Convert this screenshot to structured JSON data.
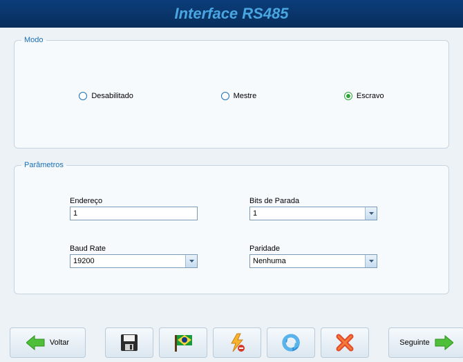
{
  "header": {
    "title": "Interface RS485"
  },
  "modo": {
    "legend": "Modo",
    "options": [
      {
        "label": "Desabilitado",
        "selected": false
      },
      {
        "label": "Mestre",
        "selected": false
      },
      {
        "label": "Escravo",
        "selected": true
      }
    ]
  },
  "param": {
    "legend": "Parâmetros",
    "endereco": {
      "label": "Endereço",
      "value": "1"
    },
    "baud": {
      "label": "Baud Rate",
      "value": "19200"
    },
    "stopbits": {
      "label": "Bits de Parada",
      "value": "1"
    },
    "paridade": {
      "label": "Paridade",
      "value": "Nenhuma"
    }
  },
  "toolbar": {
    "back": "Voltar",
    "next": "Seguinte"
  }
}
